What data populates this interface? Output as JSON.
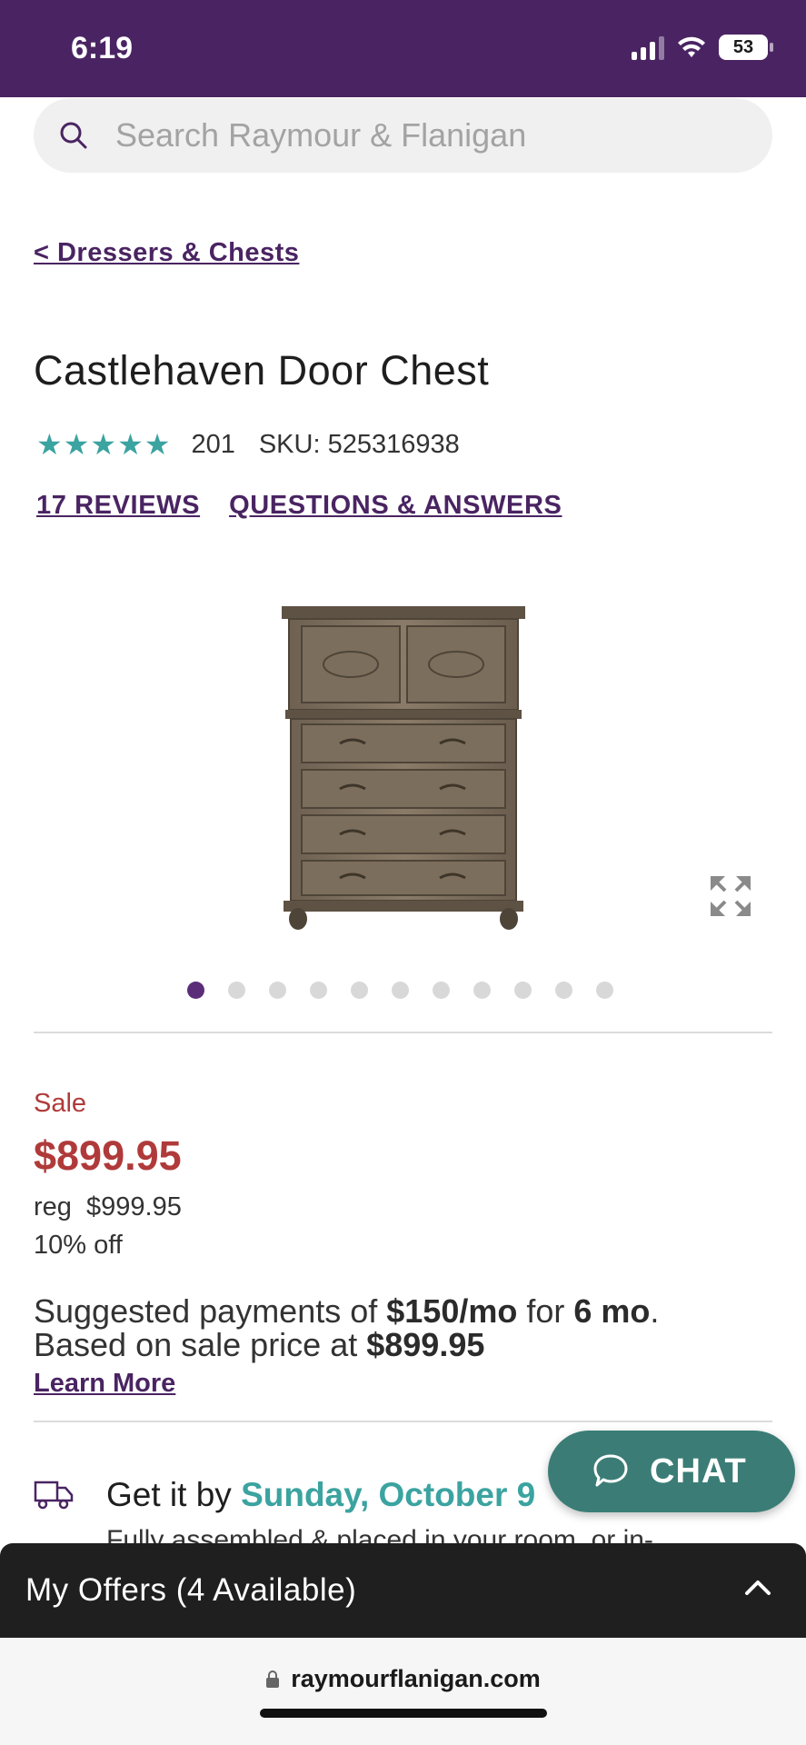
{
  "status_bar": {
    "time": "6:19",
    "battery": "53"
  },
  "search": {
    "placeholder": "Search Raymour & Flanigan"
  },
  "breadcrumb": {
    "label": "< Dressers & Chests"
  },
  "product": {
    "title": "Castlehaven Door Chest",
    "stars": "★★★★★",
    "rating_count": "201",
    "sku": "SKU: 525316938",
    "reviews_link": "17 REVIEWS",
    "qa_link": "QUESTIONS & ANSWERS",
    "image_count": 11,
    "active_image_index": 0
  },
  "pricing": {
    "sale_label": "Sale",
    "sale_price": "$899.95",
    "reg_label": "reg",
    "reg_price": "$999.95",
    "percent_off": "10% off",
    "payments_prefix": "Suggested payments of ",
    "payments_amount": "$150/mo",
    "payments_for": " for ",
    "payments_term": "6 mo",
    "payments_suffix": ". Based on sale price at ",
    "payments_price": "$899.95",
    "learn_more": "Learn More"
  },
  "delivery": {
    "prefix": "Get it by ",
    "date": "Sunday, October 9",
    "subtext": "Fully assembled & placed in your room, or in-"
  },
  "chat": {
    "label": "CHAT"
  },
  "offers": {
    "label": "My Offers (4 Available)"
  },
  "browser": {
    "url": "raymourflanigan.com"
  },
  "colors": {
    "brand_purple": "#4a2462",
    "sale_red": "#b03a3a",
    "teal": "#3ba3a0",
    "chat_green": "#3b7d76"
  },
  "icons": [
    "search-icon",
    "expand-icon",
    "truck-icon",
    "chat-bubble-icon",
    "chevron-up-icon",
    "lock-icon",
    "wifi-icon",
    "signal-icon"
  ]
}
